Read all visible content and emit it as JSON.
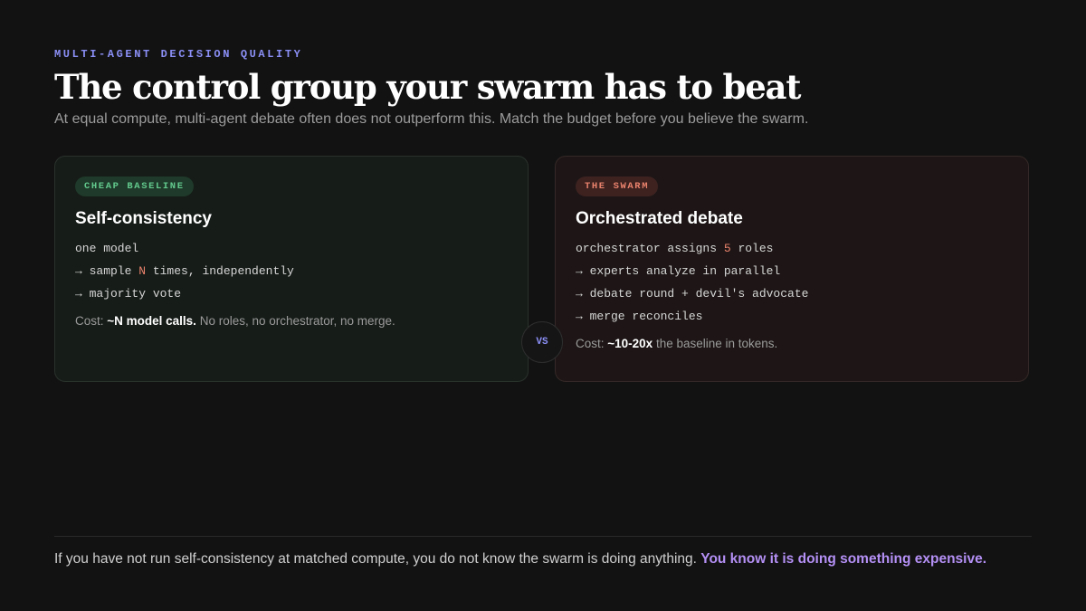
{
  "header": {
    "eyebrow": "MULTI-AGENT DECISION QUALITY",
    "title": "The control group your swarm has to beat",
    "subtitle": "At equal compute, multi-agent debate often does not outperform this. Match the budget before you believe the swarm."
  },
  "cards": {
    "baseline": {
      "badge": "CHEAP BASELINE",
      "title": "Self-consistency",
      "line1": "one model",
      "line2_pre": "→ sample ",
      "line2_accent": "N",
      "line2_post": " times, independently",
      "line3": "→ majority vote",
      "cost_label": "Cost: ",
      "cost_value": "~N model calls.",
      "cost_note": " No roles, no orchestrator, no merge."
    },
    "swarm": {
      "badge": "THE SWARM",
      "title": "Orchestrated debate",
      "line1_pre": "orchestrator assigns ",
      "line1_accent": "5",
      "line1_post": " roles",
      "line2": "→ experts analyze in parallel",
      "line3": "→ debate round + devil's advocate",
      "line4": "→ merge reconciles",
      "cost_label": "Cost: ",
      "cost_value": "~10-20x",
      "cost_note": " the baseline in tokens."
    }
  },
  "vs_label": "VS",
  "footer": {
    "text": "If you have not run self-consistency at matched compute, you do not know the swarm is doing anything. ",
    "highlight": "You know it is doing something expensive."
  },
  "colors": {
    "accent_indigo": "#8b8ff5",
    "baseline_green": "#62c98d",
    "swarm_red": "#e9826c",
    "highlight_purple": "#b490f5"
  }
}
